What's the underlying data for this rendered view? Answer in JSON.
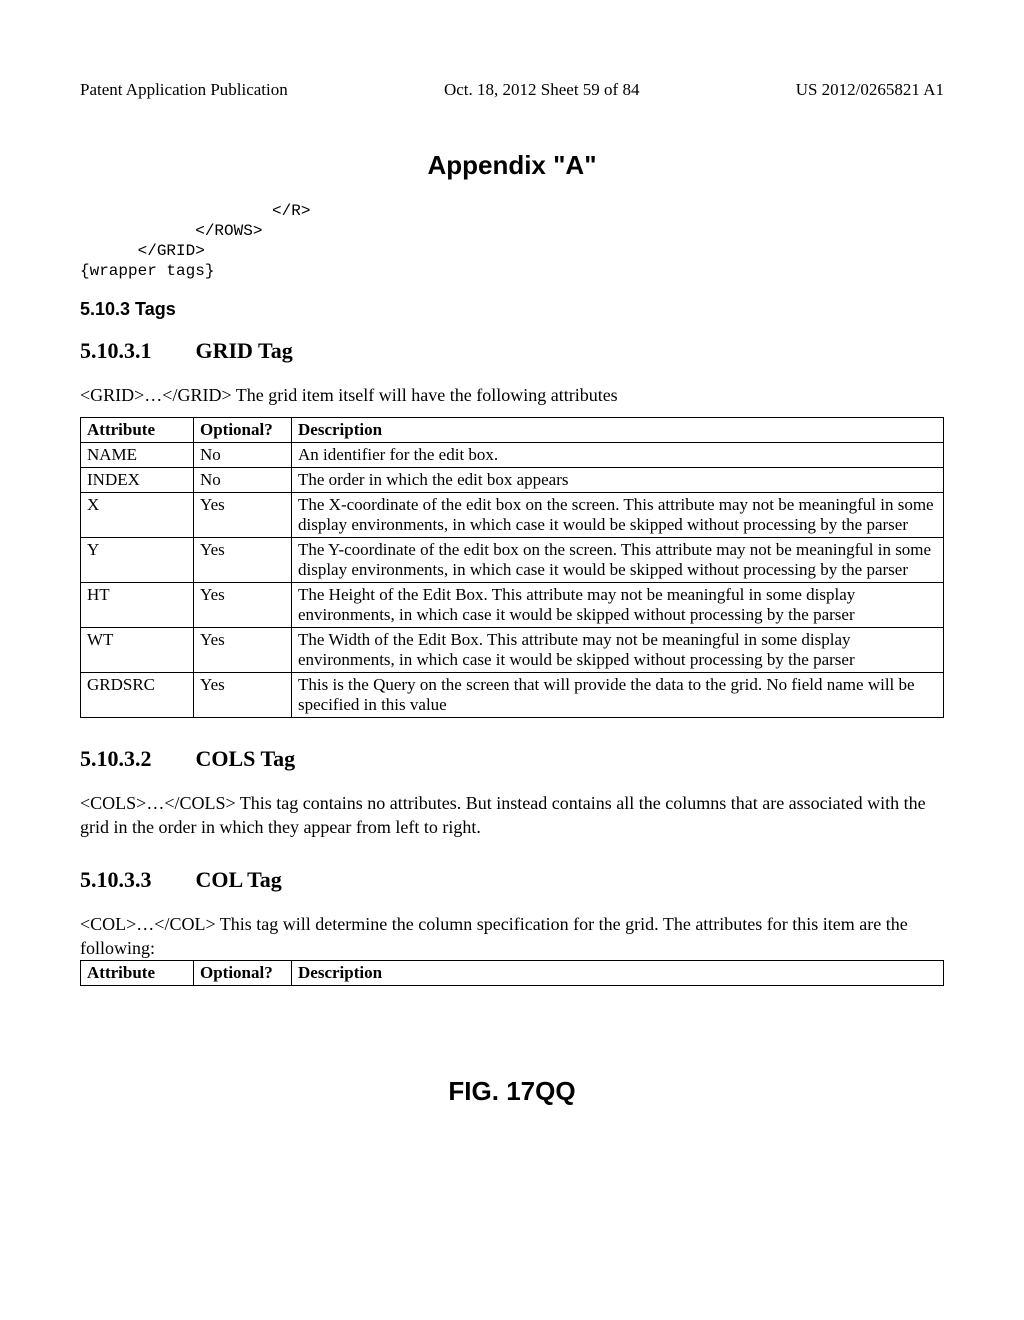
{
  "header": {
    "left": "Patent Application Publication",
    "center": "Oct. 18, 2012   Sheet 59 of 84",
    "right": "US 2012/0265821 A1"
  },
  "appendix_title": "Appendix \"A\"",
  "codeblock": "                    </R>\n            </ROWS>\n      </GRID>\n{wrapper tags}",
  "sec_tags": "5.10.3 Tags",
  "sec_grid": {
    "num": "5.10.3.1",
    "title": "GRID Tag"
  },
  "para_grid": "<GRID>…</GRID> The grid item itself will have the following attributes",
  "table1_head": {
    "c1": "Attribute",
    "c2": "Optional?",
    "c3": "Description"
  },
  "table1_rows": [
    {
      "attr": "NAME",
      "opt": "No",
      "desc": "An identifier for the edit box."
    },
    {
      "attr": "INDEX",
      "opt": "No",
      "desc": "The order in which the edit box appears"
    },
    {
      "attr": "X",
      "opt": "Yes",
      "desc": "The X-coordinate of the edit box on the screen. This attribute may not be meaningful in some display environments, in which case it would be skipped without processing by the parser"
    },
    {
      "attr": "Y",
      "opt": "Yes",
      "desc": "The Y-coordinate of the edit box on the screen. This attribute may not be meaningful in some display environments, in which case it would be skipped without processing by the parser"
    },
    {
      "attr": "HT",
      "opt": "Yes",
      "desc": "The Height of the Edit Box. This attribute may not be meaningful in some display environments, in which case it would be skipped without processing by the parser"
    },
    {
      "attr": "WT",
      "opt": "Yes",
      "desc": "The Width of the Edit Box. This attribute may not be meaningful in some display environments, in which case it would be skipped without processing by the parser"
    },
    {
      "attr": "GRDSRC",
      "opt": "Yes",
      "desc": "This is the Query on the screen that will provide the data to the grid.  No field name will be specified in this value"
    }
  ],
  "sec_cols": {
    "num": "5.10.3.2",
    "title": "COLS Tag"
  },
  "para_cols": "<COLS>…</COLS> This tag contains no attributes. But instead contains all the columns that are associated with the grid in the order in which they appear from left to right.",
  "sec_col": {
    "num": "5.10.3.3",
    "title": "COL Tag"
  },
  "para_col": "<COL>…</COL> This tag will determine the column specification for the grid.  The attributes for this item are the following:",
  "table2_head": {
    "c1": "Attribute",
    "c2": "Optional?",
    "c3": "Description"
  },
  "figure_label": "FIG. 17QQ"
}
